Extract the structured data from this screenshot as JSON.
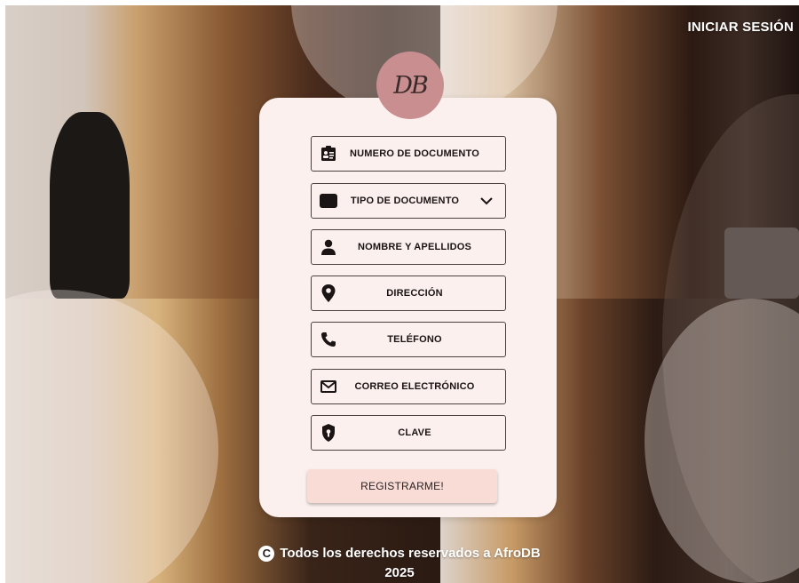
{
  "nav": {
    "login_link": "INICIAR SESIÓN"
  },
  "logo": {
    "text": "DB"
  },
  "form": {
    "fields": [
      {
        "label": "NUMERO DE DOCUMENTO",
        "icon": "id-card-icon"
      },
      {
        "label": "TIPO DE DOCUMENTO",
        "icon": "document-type-icon",
        "dropdown": true
      },
      {
        "label": "NOMBRE Y APELLIDOS",
        "icon": "user-icon"
      },
      {
        "label": "DIRECCIÓN",
        "icon": "location-pin-icon"
      },
      {
        "label": "TELÉFONO",
        "icon": "phone-icon"
      },
      {
        "label": "CORREO ELECTRÓNICO",
        "icon": "mail-icon"
      },
      {
        "label": "CLAVE",
        "icon": "lock-icon"
      }
    ],
    "submit_label": "REGISTRARME!"
  },
  "footer": {
    "copyright_symbol": "C",
    "text_line1": "Todos los derechos reservados a AfroDB",
    "text_line2": "2025"
  },
  "colors": {
    "card_bg": "#fbf0ed",
    "logo_bg": "#c98e8f",
    "button_bg": "#f9dcd5",
    "field_border": "#4a4040"
  }
}
